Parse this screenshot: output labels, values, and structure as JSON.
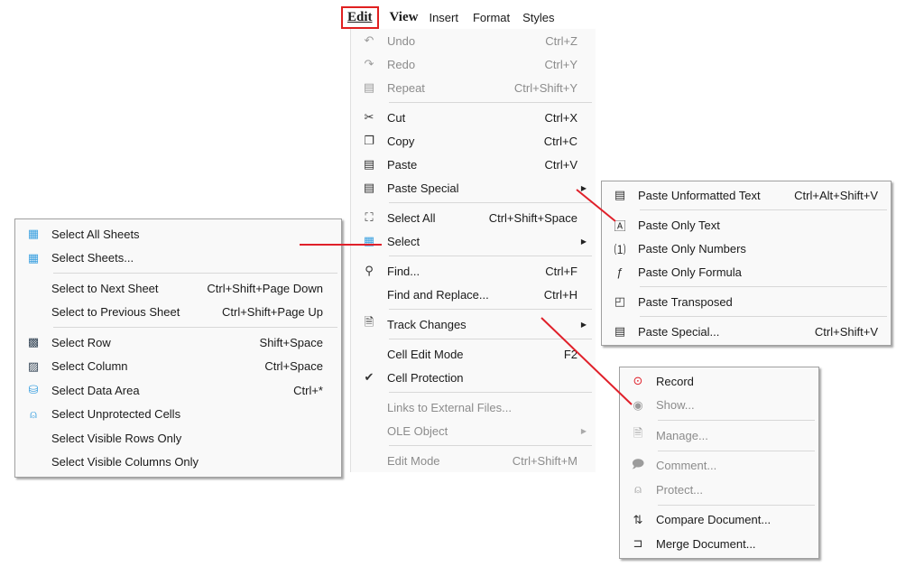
{
  "menubar": {
    "items": [
      {
        "label": "Edit",
        "underline_index": 0,
        "highlighted": true
      },
      {
        "label": "View",
        "underline_index": 0
      },
      {
        "label": "Insert",
        "underline_index": 0
      },
      {
        "label": "Format",
        "underline_index": 1
      },
      {
        "label": "Styles",
        "underline_index": 2
      }
    ]
  },
  "edit_menu": {
    "items": [
      {
        "icon": "undo-icon",
        "label": "Undo",
        "shortcut": "Ctrl+Z",
        "disabled": true
      },
      {
        "icon": "redo-icon",
        "label": "Redo",
        "shortcut": "Ctrl+Y",
        "disabled": true
      },
      {
        "icon": "repeat-icon",
        "label": "Repeat",
        "shortcut": "Ctrl+Shift+Y",
        "disabled": true
      },
      {
        "icon": "cut-icon",
        "label": "Cut",
        "shortcut": "Ctrl+X"
      },
      {
        "icon": "copy-icon",
        "label": "Copy",
        "shortcut": "Ctrl+C"
      },
      {
        "icon": "paste-icon",
        "label": "Paste",
        "shortcut": "Ctrl+V"
      },
      {
        "icon": "paste-special-icon",
        "label": "Paste Special",
        "submenu": true
      },
      {
        "icon": "select-all-icon",
        "label": "Select All",
        "shortcut": "Ctrl+Shift+Space"
      },
      {
        "icon": "select-icon",
        "label": "Select",
        "submenu": true
      },
      {
        "icon": "find-icon",
        "label": "Find...",
        "shortcut": "Ctrl+F"
      },
      {
        "icon": "",
        "label": "Find and Replace...",
        "shortcut": "Ctrl+H"
      },
      {
        "icon": "track-changes-icon",
        "label": "Track Changes",
        "submenu": true
      },
      {
        "icon": "",
        "label": "Cell Edit Mode",
        "shortcut": "F2"
      },
      {
        "icon": "checkmark-icon",
        "label": "Cell Protection",
        "checked": true
      },
      {
        "icon": "",
        "label": "Links to External Files...",
        "disabled": true
      },
      {
        "icon": "",
        "label": "OLE Object",
        "submenu": true,
        "disabled": true
      },
      {
        "icon": "",
        "label": "Edit Mode",
        "shortcut": "Ctrl+Shift+M",
        "disabled": true
      }
    ]
  },
  "select_menu": {
    "items": [
      {
        "icon": "select-all-sheets-icon",
        "label": "Select All Sheets",
        "shortcut": ""
      },
      {
        "icon": "select-sheets-icon",
        "label": "Select Sheets...",
        "shortcut": ""
      },
      {
        "icon": "",
        "label": "Select to Next Sheet",
        "shortcut": "Ctrl+Shift+Page Down"
      },
      {
        "icon": "",
        "label": "Select to Previous Sheet",
        "shortcut": "Ctrl+Shift+Page Up"
      },
      {
        "icon": "select-row-icon",
        "label": "Select Row",
        "shortcut": "Shift+Space"
      },
      {
        "icon": "select-column-icon",
        "label": "Select Column",
        "shortcut": "Ctrl+Space"
      },
      {
        "icon": "select-data-area-icon",
        "label": "Select Data Area",
        "shortcut": "Ctrl+*"
      },
      {
        "icon": "unprotected-cells-icon",
        "label": "Select Unprotected Cells",
        "shortcut": ""
      },
      {
        "icon": "",
        "label": "Select Visible Rows Only",
        "shortcut": ""
      },
      {
        "icon": "",
        "label": "Select Visible Columns Only",
        "shortcut": ""
      }
    ]
  },
  "paste_special_menu": {
    "items": [
      {
        "icon": "paste-unformatted-icon",
        "label": "Paste Unformatted Text",
        "shortcut": "Ctrl+Alt+Shift+V"
      },
      {
        "icon": "paste-only-text-icon",
        "label": "Paste Only Text",
        "shortcut": ""
      },
      {
        "icon": "paste-only-numbers-icon",
        "label": "Paste Only Numbers",
        "shortcut": ""
      },
      {
        "icon": "paste-only-formula-icon",
        "label": "Paste Only Formula",
        "shortcut": ""
      },
      {
        "icon": "paste-transposed-icon",
        "label": "Paste Transposed",
        "shortcut": ""
      },
      {
        "icon": "paste-special-icon",
        "label": "Paste Special...",
        "shortcut": "Ctrl+Shift+V"
      }
    ]
  },
  "track_changes_menu": {
    "items": [
      {
        "icon": "record-icon",
        "label": "Record"
      },
      {
        "icon": "show-icon",
        "label": "Show...",
        "disabled": true
      },
      {
        "icon": "manage-icon",
        "label": "Manage...",
        "disabled": true
      },
      {
        "icon": "comment-icon",
        "label": "Comment...",
        "disabled": true
      },
      {
        "icon": "protect-icon",
        "label": "Protect...",
        "disabled": true
      },
      {
        "icon": "compare-document-icon",
        "label": "Compare Document..."
      },
      {
        "icon": "merge-document-icon",
        "label": "Merge Document..."
      }
    ]
  },
  "colors": {
    "highlight_box": "#e02020",
    "annotation_line": "#e0202a",
    "icon_blue": "#3aa0e0",
    "disabled_text": "#8c8c8c"
  }
}
